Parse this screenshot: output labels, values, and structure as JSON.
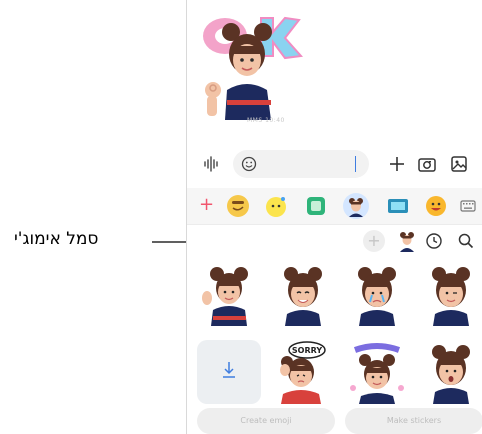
{
  "callout": {
    "label": "סמל אימוג'י"
  },
  "chat": {
    "timestamp": "MMS 10:40"
  },
  "pills": {
    "left": "Create emoji",
    "right": "Make stickers"
  },
  "colors": {
    "accent_blue": "#3f7de0",
    "selected_category": "#d4e6ff",
    "add_red": "#f1556d",
    "sticker_hair": "#5a3324",
    "sticker_shirt": "#1d2a5e"
  },
  "icons": {
    "voice": "waveform-icon",
    "emoji": "smiley-icon",
    "plus": "plus-icon",
    "camera": "camera-icon",
    "gallery": "image-icon",
    "clock": "clock-icon",
    "search": "search-icon",
    "download": "download-icon",
    "keyboard": "keyboard-icon"
  }
}
